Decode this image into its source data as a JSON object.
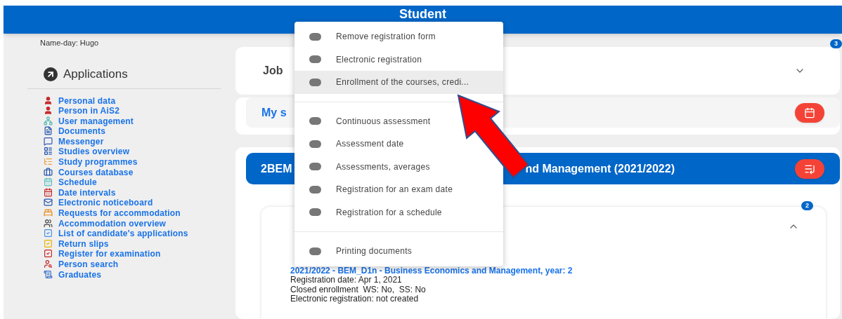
{
  "header": {
    "title": "Student"
  },
  "sidebar": {
    "name_day": "Name-day: Hugo",
    "applications_title": "Applications",
    "links": [
      "Personal data",
      "Person in AiS2",
      "User management",
      "Documents",
      "Messenger",
      "Studies overview",
      "Study programmes",
      "Courses database",
      "Schedule",
      "Date intervals",
      "Electronic noticeboard",
      "Requests for accommodation",
      "Accommodation overview",
      "List of candidate's applications",
      "Return slips",
      "Register for examination",
      "Person search",
      "Graduates"
    ]
  },
  "cards": [
    {
      "kind": "collapsible",
      "title": "Job",
      "badge": "3",
      "expanded": false
    },
    {
      "kind": "link",
      "title": "My s"
    },
    {
      "kind": "study",
      "title_start": "2BEM",
      "title_end": "nd Management (2021/2022)",
      "inner": {
        "badge": "2",
        "expanded": true,
        "link": "2021/2022 - BEM_D1n - Business Economics and Management, year: 2",
        "lines": [
          "Registration date: Apr 1, 2021",
          "Closed enrollment  WS: No,  SS: No",
          "Electronic registration: not created"
        ]
      }
    }
  ],
  "menu": {
    "groups": [
      [
        {
          "label": "Remove registration form",
          "highlighted": false
        },
        {
          "label": "Electronic registration",
          "highlighted": false
        },
        {
          "label": "Enrollment of the courses, credi...",
          "highlighted": true
        }
      ],
      [
        {
          "label": "Continuous assessment",
          "highlighted": false
        },
        {
          "label": "Assessment date",
          "highlighted": false
        },
        {
          "label": "Assessments, averages",
          "highlighted": false
        },
        {
          "label": "Registration for an exam date",
          "highlighted": false
        },
        {
          "label": "Registration for a schedule",
          "highlighted": false
        }
      ],
      [
        {
          "label": "Printing documents",
          "highlighted": false
        }
      ]
    ]
  }
}
